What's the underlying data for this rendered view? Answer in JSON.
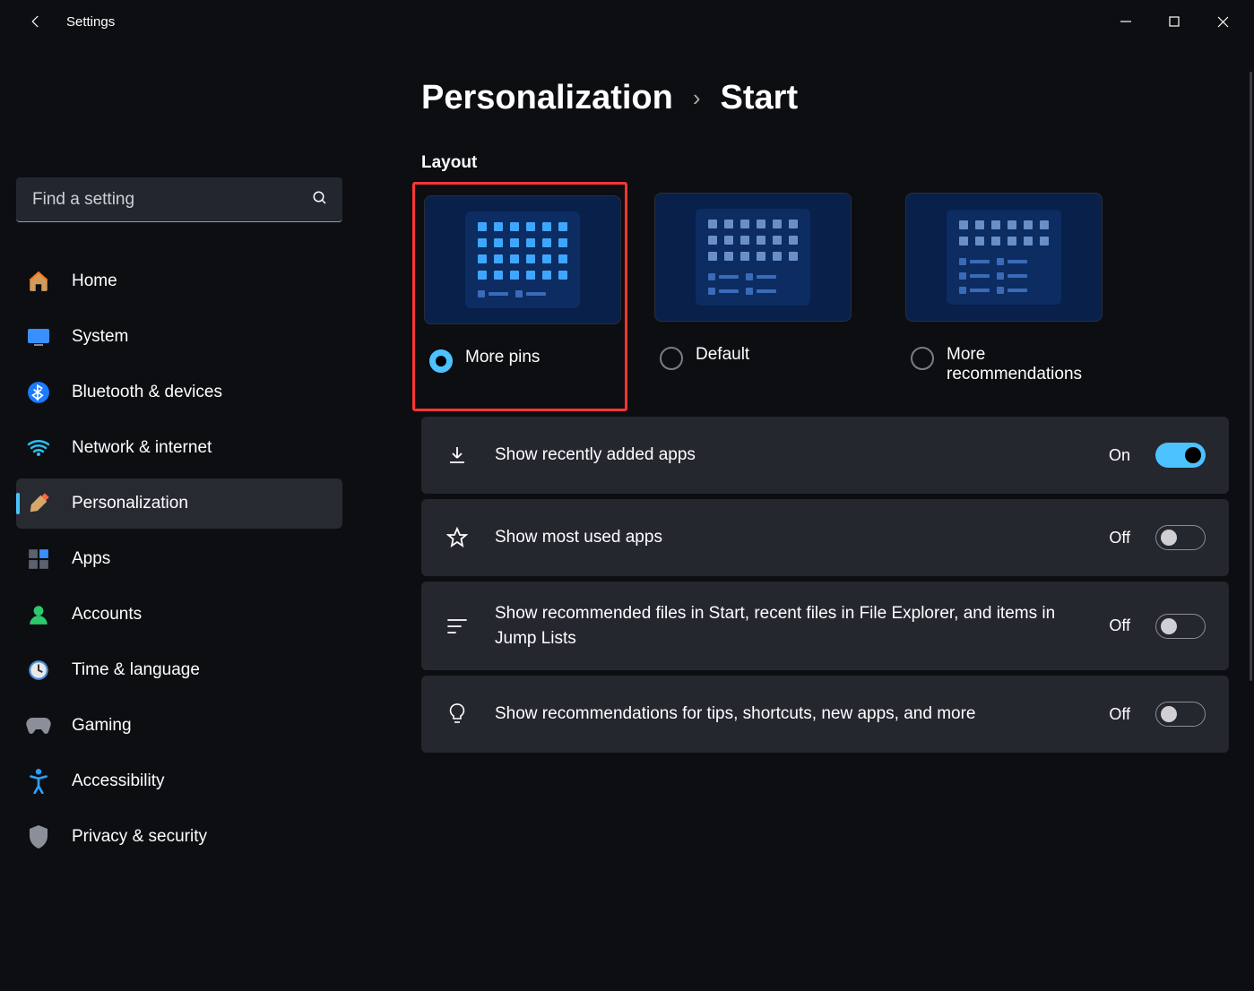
{
  "titlebar": {
    "title": "Settings"
  },
  "search": {
    "placeholder": "Find a setting"
  },
  "sidebar": {
    "items": [
      {
        "label": "Home"
      },
      {
        "label": "System"
      },
      {
        "label": "Bluetooth & devices"
      },
      {
        "label": "Network & internet"
      },
      {
        "label": "Personalization"
      },
      {
        "label": "Apps"
      },
      {
        "label": "Accounts"
      },
      {
        "label": "Time & language"
      },
      {
        "label": "Gaming"
      },
      {
        "label": "Accessibility"
      },
      {
        "label": "Privacy & security"
      }
    ]
  },
  "breadcrumb": {
    "parent": "Personalization",
    "child": "Start"
  },
  "layout": {
    "heading": "Layout",
    "options": [
      {
        "label": "More pins",
        "selected": true
      },
      {
        "label": "Default",
        "selected": false
      },
      {
        "label": "More recommendations",
        "selected": false
      }
    ]
  },
  "settings": [
    {
      "label": "Show recently added apps",
      "state": "On",
      "on": true
    },
    {
      "label": "Show most used apps",
      "state": "Off",
      "on": false
    },
    {
      "label": "Show recommended files in Start, recent files in File Explorer, and items in Jump Lists",
      "state": "Off",
      "on": false
    },
    {
      "label": "Show recommendations for tips, shortcuts, new apps, and more",
      "state": "Off",
      "on": false
    }
  ]
}
